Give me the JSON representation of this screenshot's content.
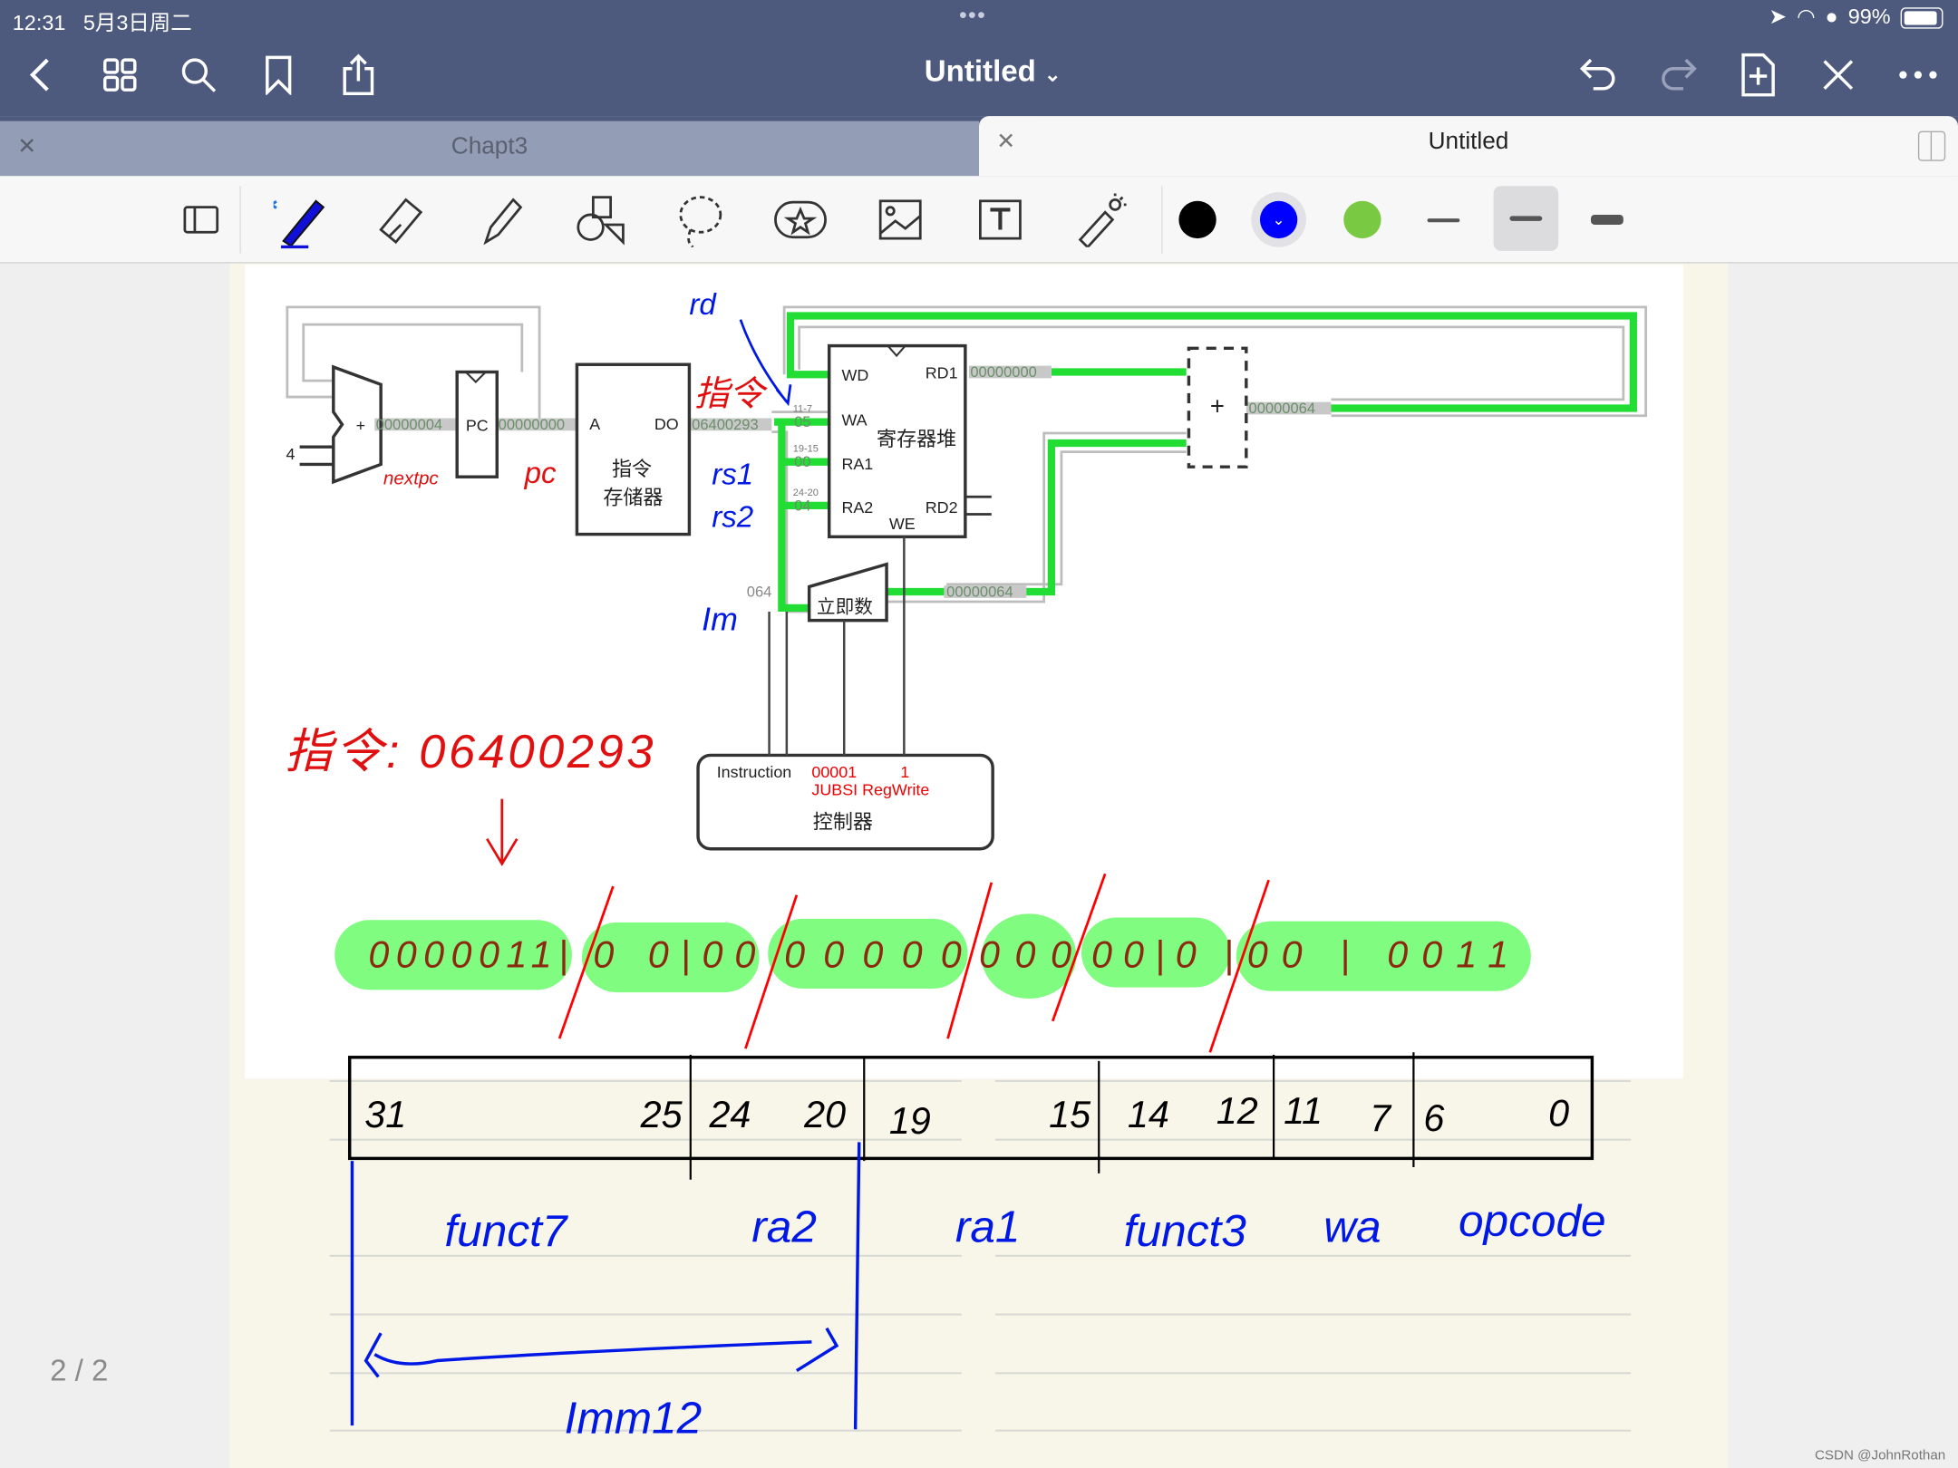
{
  "status_bar": {
    "time": "12:31",
    "date": "5月3日周二",
    "battery": "99%",
    "battery_level": 0.99
  },
  "nav": {
    "title": "Untitled",
    "icons": [
      "back-icon",
      "grid-icon",
      "search-icon",
      "bookmark-icon",
      "share-icon",
      "undo-icon",
      "redo-icon",
      "add-page-icon",
      "close-pen-icon",
      "more-icon"
    ]
  },
  "tabs": [
    {
      "label": "Chapt3",
      "active": false
    },
    {
      "label": "Untitled",
      "active": true
    }
  ],
  "toolbar": {
    "tools": [
      "read-mode",
      "pen",
      "eraser",
      "highlighter",
      "shapes",
      "lasso",
      "sticker",
      "image",
      "text",
      "laser-pointer"
    ],
    "colors": [
      "#000000",
      "#0000ff",
      "#7ac943"
    ],
    "selected_color": "#0000ff",
    "stroke_widths": [
      "thin",
      "medium",
      "thick"
    ],
    "selected_width": "medium"
  },
  "diagram": {
    "adder_plus": "+",
    "adder_value": "00000004",
    "const_four": "4",
    "pc_label": "PC",
    "pc_value": "00000000",
    "imem_a": "A",
    "imem_do": "DO",
    "imem_name_1": "指令",
    "imem_name_2": "存储器",
    "instr_value": "06400293",
    "split_11_7": "11-7",
    "wa_value": "05",
    "split_19_15": "19-15",
    "ra1_value": "00",
    "split_24_20": "24-20",
    "ra2_value": "04",
    "rf_wd": "WD",
    "rf_rd1": "RD1",
    "rf_wa": "WA",
    "rf_name": "寄存器堆",
    "rf_ra1": "RA1",
    "rf_ra2": "RA2",
    "rf_rd2": "RD2",
    "rf_we": "WE",
    "rd1_value": "00000000",
    "alu_plus": "+",
    "alu_value": "00000064",
    "imm_in": "064",
    "imm_name": "立即数",
    "imm_value": "00000064",
    "ctrl_instruction": "Instruction",
    "ctrl_code": "00001",
    "ctrl_one": "1",
    "ctrl_signals": "JUBSI RegWrite",
    "ctrl_name": "控制器"
  },
  "annotations": {
    "rd": "rd",
    "instr": "指令",
    "nextpc": "nextpc",
    "pc": "pc",
    "rs1": "rs1",
    "rs2": "rs2",
    "im": "Im",
    "instr_line": "指令: 06400293",
    "binary_groups": [
      "0000011|",
      "0 0|00",
      "00000",
      "000",
      "00|0",
      "|00 | 0011"
    ],
    "bits": [
      "31",
      "25",
      "24",
      "20",
      "19",
      "15",
      "14",
      "12",
      "11",
      "7",
      "6",
      "0"
    ],
    "fields": [
      "funct7",
      "ra2",
      "ra1",
      "funct3",
      "wa",
      "opcode"
    ],
    "imm12": "Imm12"
  },
  "page_indicator": "2 / 2",
  "watermark": "CSDN @JohnRothan"
}
